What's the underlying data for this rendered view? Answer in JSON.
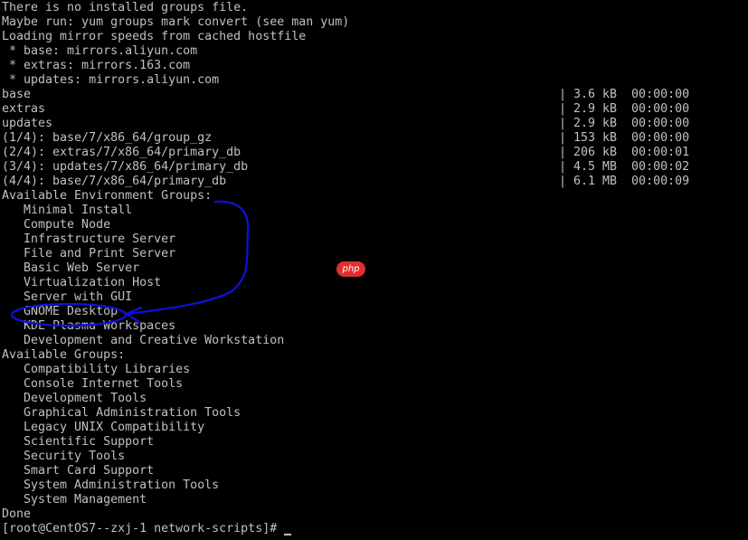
{
  "terminal": {
    "output_lines": [
      "There is no installed groups file.",
      "Maybe run: yum groups mark convert (see man yum)",
      "Loading mirror speeds from cached hostfile",
      " * base: mirrors.aliyun.com",
      " * extras: mirrors.163.com",
      " * updates: mirrors.aliyun.com",
      "base",
      "extras",
      "updates",
      "(1/4): base/7/x86_64/group_gz",
      "(2/4): extras/7/x86_64/primary_db",
      "(3/4): updates/7/x86_64/primary_db",
      "(4/4): base/7/x86_64/primary_db",
      "Available Environment Groups:",
      "   Minimal Install",
      "   Compute Node",
      "   Infrastructure Server",
      "   File and Print Server",
      "   Basic Web Server",
      "   Virtualization Host",
      "   Server with GUI",
      "   GNOME Desktop",
      "   KDE Plasma Workspaces",
      "   Development and Creative Workstation",
      "Available Groups:",
      "   Compatibility Libraries",
      "   Console Internet Tools",
      "   Development Tools",
      "   Graphical Administration Tools",
      "   Legacy UNIX Compatibility",
      "   Scientific Support",
      "   Security Tools",
      "   Smart Card Support",
      "   System Administration Tools",
      "   System Management",
      "Done",
      "[root@CentOS7--zxj-1 network-scripts]# "
    ],
    "download_stats": [
      {
        "row": 6,
        "text": "| 3.6 kB  00:00:00"
      },
      {
        "row": 7,
        "text": "| 2.9 kB  00:00:00"
      },
      {
        "row": 8,
        "text": "| 2.9 kB  00:00:00"
      },
      {
        "row": 9,
        "text": "| 153 kB  00:00:00"
      },
      {
        "row": 10,
        "text": "| 206 kB  00:00:01"
      },
      {
        "row": 11,
        "text": "| 4.5 MB  00:00:02"
      },
      {
        "row": 12,
        "text": "| 6.1 MB  00:00:09"
      }
    ]
  },
  "annotation": {
    "color": "#1010dd",
    "circled_item": "GNOME Desktop"
  },
  "watermark": {
    "text": "php",
    "color": "#e0302e"
  },
  "colors": {
    "background": "#000000",
    "foreground": "#c0c0c0"
  }
}
